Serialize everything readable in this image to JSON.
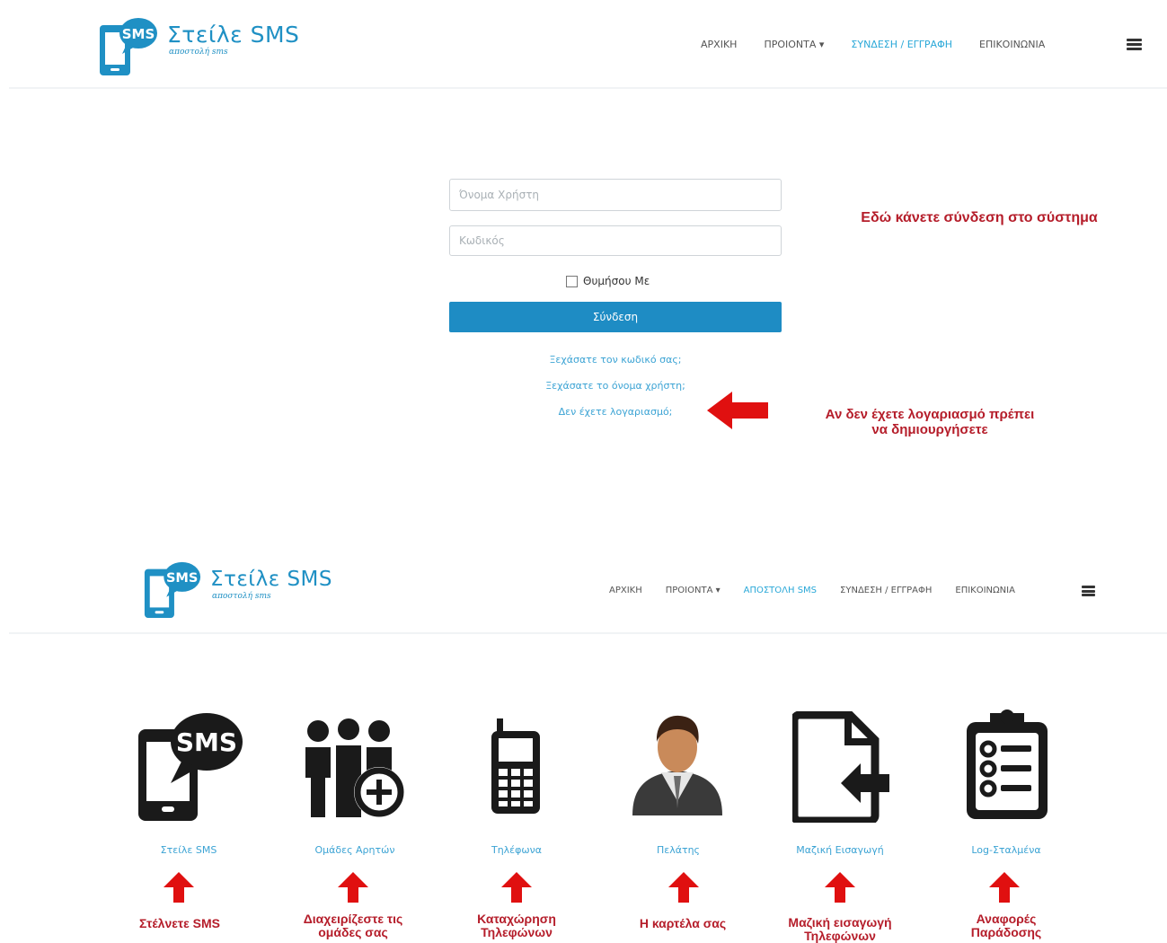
{
  "header1": {
    "logo": {
      "sms_badge": "SMS",
      "title": "Στείλε SMS",
      "subtitle": "αποστολή sms"
    },
    "nav": [
      {
        "label": "ΑΡΧΙΚΗ",
        "active": false
      },
      {
        "label": "ΠΡΟΙΟΝΤΑ ▾",
        "active": false
      },
      {
        "label": "ΣΥΝΔΕΣΗ / ΕΓΓΡΑΦΗ",
        "active": true
      },
      {
        "label": "ΕΠΙΚΟΙΝΩΝΙΑ",
        "active": false
      }
    ],
    "menu_icon": "hamburger-icon"
  },
  "login": {
    "username_placeholder": "Όνομα Χρήστη",
    "password_placeholder": "Κωδικός",
    "remember_label": "Θυμήσου Με",
    "submit_label": "Σύνδεση",
    "links": [
      "Ξεχάσατε τον κωδικό σας;",
      "Ξεχάσατε το όνομα χρήστη;",
      "Δεν έχετε λογαριασμό;"
    ],
    "note_login": "Εδώ κάνετε σύνδεση στο σύστημα",
    "note_register_1": "Αν δεν έχετε λογαριασμό πρέπει",
    "note_register_2": "να δημιουργήσετε"
  },
  "header2": {
    "logo": {
      "sms_badge": "SMS",
      "title": "Στείλε SMS",
      "subtitle": "αποστολή sms"
    },
    "nav": [
      {
        "label": "ΑΡΧΙΚΗ",
        "active": false
      },
      {
        "label": "ΠΡΟΙΟΝΤΑ ▾",
        "active": false
      },
      {
        "label": "ΑΠΟΣΤΟΛΗ SMS",
        "active": true
      },
      {
        "label": "ΣΥΝΔΕΣΗ / ΕΓΓΡΑΦΗ",
        "active": false
      },
      {
        "label": "ΕΠΙΚΟΙΝΩΝΙΑ",
        "active": false
      }
    ],
    "menu_icon": "hamburger-icon"
  },
  "features": [
    {
      "icon": "sms-phone-icon",
      "badge": "SMS",
      "label": "Στείλε SMS",
      "desc_1": "Στέλνετε SMS",
      "desc_2": ""
    },
    {
      "icon": "groups-add-icon",
      "badge": "",
      "label": "Ομάδες Αρητών",
      "desc_1": "Διαχειρίζεστε τις",
      "desc_2": "ομάδες σας"
    },
    {
      "icon": "mobile-phone-icon",
      "badge": "",
      "label": "Τηλέφωνα",
      "desc_1": "Καταχώρηση",
      "desc_2": "Τηλεφώνων"
    },
    {
      "icon": "customer-avatar-icon",
      "badge": "",
      "label": "Πελάτης",
      "desc_1": "Η καρτέλα σας",
      "desc_2": ""
    },
    {
      "icon": "file-import-icon",
      "badge": "",
      "label": "Μαζική Εισαγωγή",
      "desc_1": "Μαζική εισαγωγή",
      "desc_2": "Τηλεφώνων"
    },
    {
      "icon": "clipboard-checklist-icon",
      "badge": "",
      "label": "Log-Σταλμένα",
      "desc_1": "Αναφορές",
      "desc_2": "Παράδοσης"
    }
  ],
  "colors": {
    "accent": "#1e8cc4",
    "link": "#3ba3d4",
    "annotation": "#b51d2a",
    "arrow": "#e01010",
    "icon": "#1a1a1a"
  }
}
